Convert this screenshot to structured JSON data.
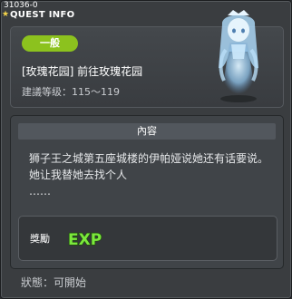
{
  "window": {
    "id_label": "31036-0",
    "title": "QUEST INFO"
  },
  "quest": {
    "category": "一般",
    "name": "[玫瑰花园] 前往玫瑰花园",
    "level_range": "建議等级：115～119"
  },
  "content": {
    "header": "內容",
    "text": "狮子王之城第五座城楼的伊帕娅说她还有话要说。\n她让我替她去找个人\n……"
  },
  "reward": {
    "label": "獎勵",
    "exp_icon": "exp-icon",
    "exp_text": "EXP"
  },
  "status": "狀態：可開始",
  "colors": {
    "category_badge": "#8cc21e",
    "panel_bg": "#3a3d40",
    "exp_green": "#6fe23a"
  }
}
